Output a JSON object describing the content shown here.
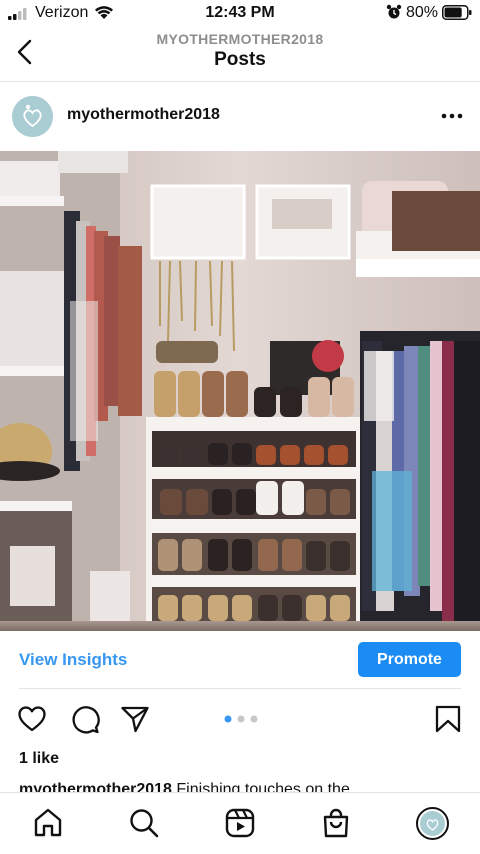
{
  "status_bar": {
    "carrier": "Verizon",
    "time": "12:43 PM",
    "battery": "80%",
    "battery_level": 0.8
  },
  "header": {
    "account": "MYOTHERMOTHER2018",
    "title": "Posts"
  },
  "post": {
    "username": "myothermother2018",
    "image_alt": "Walk-in closet with shoe shelves, jewelry organizers and hanging clothes",
    "insights_label": "View Insights",
    "promote_label": "Promote",
    "carousel": {
      "count": 3,
      "active": 1
    },
    "likes": "1 like",
    "caption_user": "myothermother2018",
    "caption_text": "Finishing touches on the"
  },
  "icons": {
    "back": "chevron-left-icon",
    "more": "more-horizontal-icon",
    "like": "heart-icon",
    "comment": "comment-icon",
    "share": "paper-plane-icon",
    "save": "bookmark-icon",
    "home": "home-icon",
    "search": "search-icon",
    "reels": "reels-icon",
    "shop": "shopping-bag-icon"
  },
  "colors": {
    "link_blue": "#3897f0",
    "promote_blue": "#1a8cf3",
    "avatar_bg": "#a9cdd3"
  }
}
